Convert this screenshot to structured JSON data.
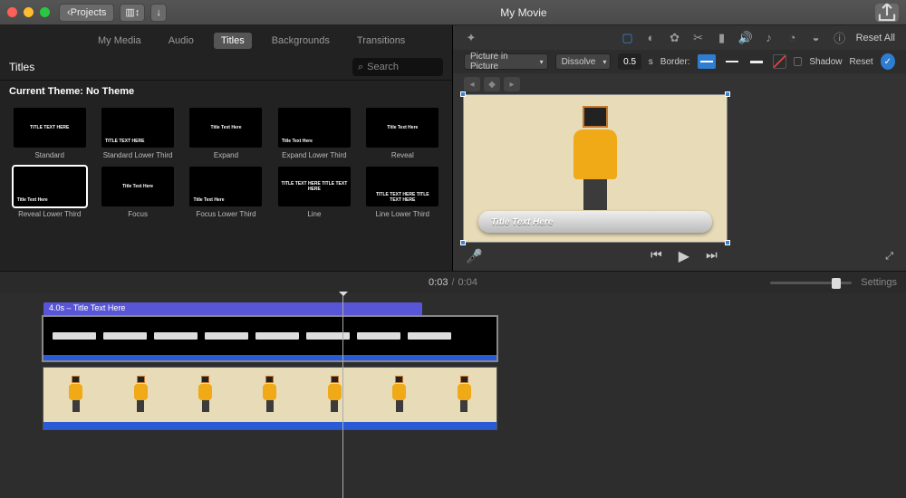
{
  "titlebar": {
    "back_label": "Projects",
    "title": "My Movie"
  },
  "tabs": {
    "items": [
      "My Media",
      "Audio",
      "Titles",
      "Backgrounds",
      "Transitions"
    ],
    "active": "Titles"
  },
  "browser": {
    "section": "Titles",
    "search_placeholder": "Search",
    "theme": "Current Theme: No Theme",
    "titles": [
      {
        "name": "Standard",
        "text": "TITLE TEXT HERE",
        "pos": "center"
      },
      {
        "name": "Standard Lower Third",
        "text": "TITLE TEXT HERE",
        "pos": "bl"
      },
      {
        "name": "Expand",
        "text": "Title Text Here",
        "pos": "center"
      },
      {
        "name": "Expand Lower Third",
        "text": "Title Text Here",
        "pos": "bl"
      },
      {
        "name": "Reveal",
        "text": "Title Text Here",
        "pos": "center"
      },
      {
        "name": "Reveal Lower Third",
        "text": "Title Text Here",
        "pos": "bl",
        "selected": true
      },
      {
        "name": "Focus",
        "text": "Title Text Here",
        "pos": "center"
      },
      {
        "name": "Focus Lower Third",
        "text": "Title Text Here",
        "pos": "bl"
      },
      {
        "name": "Line",
        "text": "TITLE TEXT HERE\\nTITLE TEXT HERE",
        "pos": "center"
      },
      {
        "name": "Line Lower Third",
        "text": "TITLE TEXT HERE\\nTITLE TEXT HERE",
        "pos": "bc"
      }
    ]
  },
  "inspector": {
    "reset_all": "Reset All",
    "mode": "Picture in Picture",
    "transition": "Dissolve",
    "duration": "0.5",
    "duration_suffix": "s",
    "border_label": "Border:",
    "shadow_label": "Shadow",
    "reset_label": "Reset"
  },
  "preview": {
    "title_text": "Title Text Here"
  },
  "playbar": {
    "time": "0:03",
    "duration": "0:04",
    "settings": "Settings"
  },
  "timeline": {
    "title_clip": "4.0s – Title Text Here"
  }
}
